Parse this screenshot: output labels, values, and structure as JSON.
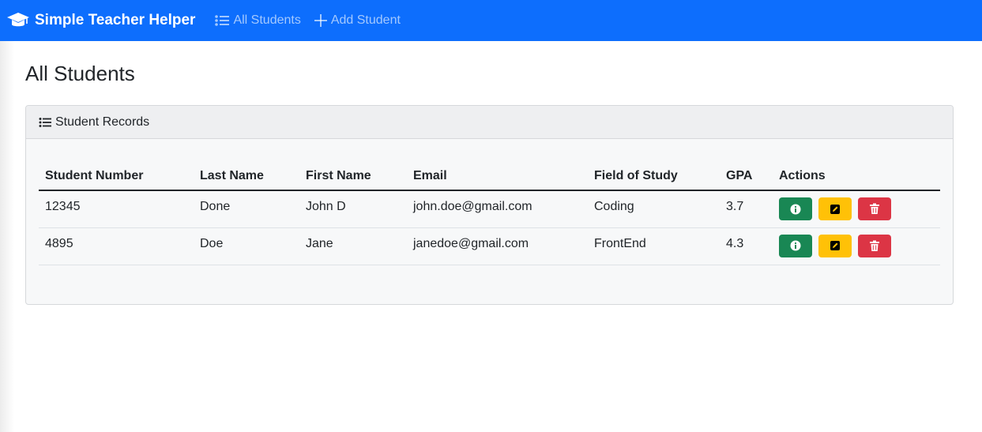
{
  "navbar": {
    "brand": "Simple Teacher Helper",
    "links": [
      {
        "label": "All Students",
        "icon": "list-icon"
      },
      {
        "label": "Add Student",
        "icon": "plus-icon"
      }
    ]
  },
  "page": {
    "title": "All Students"
  },
  "card": {
    "header": "Student Records",
    "table": {
      "columns": [
        "Student Number",
        "Last Name",
        "First Name",
        "Email",
        "Field of Study",
        "GPA",
        "Actions"
      ],
      "rows": [
        {
          "student_number": "12345",
          "last_name": "Done",
          "first_name": "John D",
          "email": "john.doe@gmail.com",
          "field": "Coding",
          "gpa": "3.7"
        },
        {
          "student_number": "4895",
          "last_name": "Doe",
          "first_name": "Jane",
          "email": "janedoe@gmail.com",
          "field": "FrontEnd",
          "gpa": "4.3"
        }
      ],
      "actions": [
        {
          "name": "info",
          "icon": "info-circle-icon",
          "color": "#198754"
        },
        {
          "name": "edit",
          "icon": "pencil-square-icon",
          "color": "#ffc107"
        },
        {
          "name": "delete",
          "icon": "trash-icon",
          "color": "#dc3545"
        }
      ]
    }
  },
  "colors": {
    "navbar": "#0d6efd",
    "success": "#198754",
    "warning": "#ffc107",
    "danger": "#dc3545"
  }
}
